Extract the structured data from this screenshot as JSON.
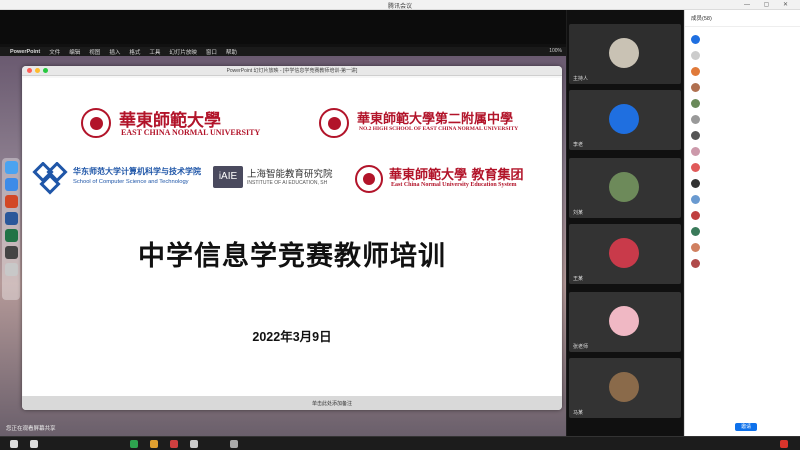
{
  "window": {
    "title": "腾讯会议"
  },
  "share": {
    "status": "您正在观看屏幕共享"
  },
  "mac_menubar": {
    "app": "PowerPoint",
    "menus": [
      "文件",
      "编辑",
      "视图",
      "插入",
      "格式",
      "工具",
      "幻灯片放映",
      "窗口",
      "帮助"
    ],
    "status": "100%"
  },
  "ppt": {
    "title": "PowerPoint 幻灯片放映 - [中学信息学竞赛教师培训-第一讲]",
    "notes": "单击此处添加备注"
  },
  "slide": {
    "logo1_cn": "華東師範大學",
    "logo1_en": "EAST CHINA NORMAL UNIVERSITY",
    "logo2_cn": "華東師範大學第二附属中學",
    "logo2_en": "NO.2 HIGH SCHOOL OF EAST CHINA NORMAL UNIVERSITY",
    "logo3_cn": "华东师范大学计算机科学与技术学院",
    "logo3_en": "School of Computer Science and Technology",
    "logo4_badge": "iAIE",
    "logo4_cn": "上海智能教育研究院",
    "logo4_en": "INSTITUTE OF AI EDUCATION, SH",
    "logo5_cn": "華東師範大學 教育集团",
    "logo5_en": "East China Normal University Education System",
    "title": "中学信息学竞赛教师培训",
    "date": "2022年3月9日"
  },
  "video_tiles": [
    {
      "name": "主持人"
    },
    {
      "name": "李老"
    },
    {
      "name": "刘某"
    },
    {
      "name": "王某"
    },
    {
      "name": "张老师"
    },
    {
      "name": "马某"
    }
  ],
  "participants": {
    "header": "成员(58)",
    "invite_label": "邀请"
  },
  "colors": {
    "brand_red": "#b2142a",
    "accent_blue": "#0e71eb"
  }
}
